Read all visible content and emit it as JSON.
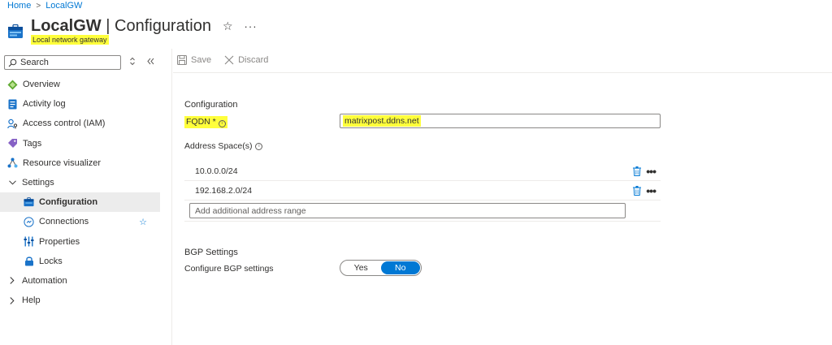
{
  "breadcrumb": {
    "home": "Home",
    "current": "LocalGW"
  },
  "header": {
    "resource_name": "LocalGW",
    "separator": "|",
    "page": "Configuration",
    "subtitle": "Local network gateway",
    "star_glyph": "☆",
    "more_glyph": "···"
  },
  "sidebar": {
    "search_placeholder": "Search",
    "items": [
      {
        "label": "Overview"
      },
      {
        "label": "Activity log"
      },
      {
        "label": "Access control (IAM)"
      },
      {
        "label": "Tags"
      },
      {
        "label": "Resource visualizer"
      },
      {
        "label": "Settings"
      },
      {
        "label": "Configuration"
      },
      {
        "label": "Connections"
      },
      {
        "label": "Properties"
      },
      {
        "label": "Locks"
      },
      {
        "label": "Automation"
      },
      {
        "label": "Help"
      }
    ]
  },
  "toolbar": {
    "save": "Save",
    "discard": "Discard"
  },
  "configuration": {
    "section_title": "Configuration",
    "fqdn_label": "FQDN *",
    "fqdn_value": "matrixpost.ddns.net",
    "address_space_label": "Address Space(s)",
    "address_ranges": [
      "10.0.0.0/24",
      "192.168.2.0/24"
    ],
    "add_placeholder": "Add additional address range"
  },
  "bgp": {
    "section_title": "BGP Settings",
    "configure_label": "Configure BGP settings",
    "yes": "Yes",
    "no": "No",
    "selected": "No"
  },
  "colors": {
    "accent": "#0078d4",
    "highlight": "#ffff3b"
  }
}
